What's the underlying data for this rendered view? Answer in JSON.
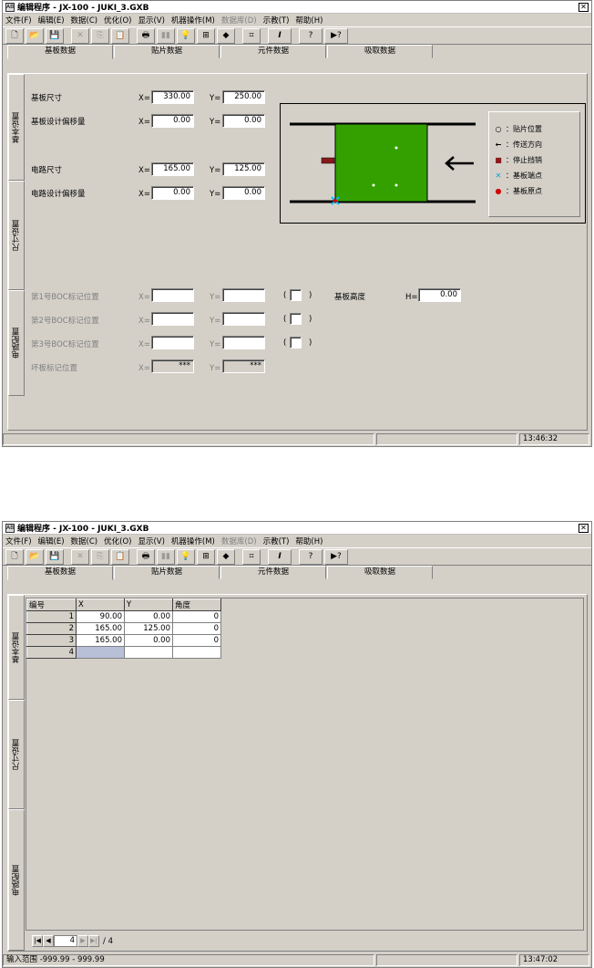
{
  "window": {
    "title": "编辑程序 - JX-100 - JUKI_3.GXB",
    "icon_label": "AB"
  },
  "menu": [
    "文件(F)",
    "编辑(E)",
    "数据(C)",
    "优化(O)",
    "显示(V)",
    "机器操作(M)",
    "数据库(D)",
    "示教(T)",
    "帮助(H)"
  ],
  "menu_disabled_index": 6,
  "toolbar": {
    "new": "🗋",
    "open": "📂",
    "save": "💾",
    "cut": "✕",
    "copy": "⎘",
    "paste": "📋",
    "print": "🖶",
    "find": "▮▮",
    "light": "💡",
    "sort": "⊞",
    "components": "◆",
    "mark": "⌗",
    "text": "I",
    "help": "?",
    "whatsthis": "▶?"
  },
  "tabs": [
    "基板数据",
    "贴片数据",
    "元件数据",
    "吸取数据"
  ],
  "side_tabs": [
    "基本设置",
    "尺寸设置",
    "电路配置"
  ],
  "screen1": {
    "board_size": {
      "label": "基板尺寸",
      "x": "330.00",
      "y": "250.00"
    },
    "board_offset": {
      "label": "基板设计偏移量",
      "x": "0.00",
      "y": "0.00"
    },
    "circuit_size": {
      "label": "电路尺寸",
      "x": "165.00",
      "y": "125.00"
    },
    "circuit_offset": {
      "label": "电路设计偏移量",
      "x": "0.00",
      "y": "0.00"
    },
    "boc1": {
      "label": "第1号BOC标记位置",
      "x": "",
      "y": ""
    },
    "boc2": {
      "label": "第2号BOC标记位置",
      "x": "",
      "y": ""
    },
    "boc3": {
      "label": "第3号BOC标记位置",
      "x": "",
      "y": ""
    },
    "bad_mark": {
      "label": "坏板标记位置",
      "x": "***",
      "y": "***"
    },
    "board_height": {
      "label": "基板高度",
      "value": "0.00"
    },
    "x_prefix": "X=",
    "y_prefix": "Y=",
    "h_prefix": "H=",
    "paren_open": "(",
    "paren_close": ")",
    "legend": [
      "：贴片位置",
      "：传送方向",
      "：停止挡销",
      "：基板端点",
      "：基板原点"
    ],
    "time": "13:46:32"
  },
  "screen2": {
    "table_headers": [
      "编号",
      "X",
      "Y",
      "角度"
    ],
    "rows": [
      [
        "1",
        "90.00",
        "0.00",
        "0"
      ],
      [
        "2",
        "165.00",
        "125.00",
        "0"
      ],
      [
        "3",
        "165.00",
        "0.00",
        "0"
      ],
      [
        "4",
        "",
        "",
        ""
      ]
    ],
    "pager": {
      "current": "4",
      "total": "/ 4"
    },
    "status_text": "输入范围 -999.99 - 999.99",
    "time": "13:47:02"
  },
  "colors": {
    "board_green": "#33a000",
    "stopper": "#8b1a1a",
    "window_face": "#d4d0c8"
  }
}
